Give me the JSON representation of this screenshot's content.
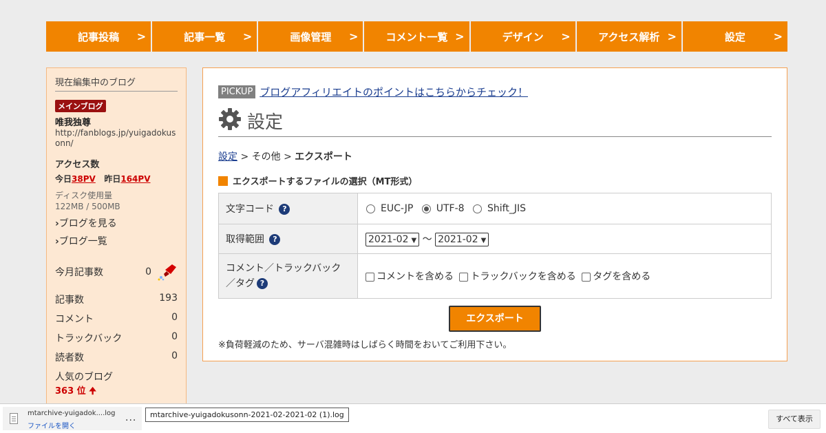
{
  "nav": {
    "items": [
      {
        "label": "記事投稿"
      },
      {
        "label": "記事一覧"
      },
      {
        "label": "画像管理"
      },
      {
        "label": "コメント一覧"
      },
      {
        "label": "デザイン"
      },
      {
        "label": "アクセス解析"
      },
      {
        "label": "設定"
      }
    ],
    "chevron": ">"
  },
  "sidebar": {
    "heading": "現在編集中のブログ",
    "badge": "メインブログ",
    "blog_name": "唯我独尊",
    "blog_url": "http://fanblogs.jp/yuigadokusonn/",
    "access_title": "アクセス数",
    "today_label": "今日",
    "today_value": "38PV",
    "yesterday_label": "昨日",
    "yesterday_value": "164PV",
    "disk_label": "ディスク使用量",
    "disk_value": "122MB / 500MB",
    "link_view": "ブログを見る",
    "link_list": "ブログ一覧",
    "link_arrow": "›",
    "stats": [
      {
        "label": "今月記事数",
        "value": "0"
      },
      {
        "label": "記事数",
        "value": "193"
      },
      {
        "label": "コメント",
        "value": "0"
      },
      {
        "label": "トラックバック",
        "value": "0"
      },
      {
        "label": "読者数",
        "value": "0"
      }
    ],
    "popular_label": "人気のブログ",
    "popular_rank": "363 位",
    "rank_arrow": "🠉"
  },
  "main": {
    "pickup_label": "PICKUP",
    "pickup_link": "ブログアフィリエイトのポイントはこちらからチェック！",
    "title": "設定",
    "breadcrumb": {
      "root": "設定",
      "sep1": " > ",
      "mid": "その他",
      "sep2": " > ",
      "current": "エクスポート"
    },
    "section_title": "エクスポートするファイルの選択（MT形式）",
    "rows": {
      "charset_label": "文字コード",
      "charset_options": [
        "EUC-JP",
        "UTF-8",
        "Shift_JIS"
      ],
      "charset_selected": "UTF-8",
      "range_label": "取得範囲",
      "range_from": "2021-02",
      "range_sep": "～",
      "range_to": "2021-02",
      "include_label_1": "コメント／トラックバック",
      "include_label_2": "／タグ",
      "include_options": [
        "コメントを含める",
        "トラックバックを含める",
        "タグを含める"
      ]
    },
    "help_glyph": "?",
    "export_button": "エクスポート",
    "note": "※負荷軽減のため、サーバ混雑時はしばらく時間をおいてご利用下さい。"
  },
  "download_bar": {
    "file_name": "mtarchive-yuigadok....log",
    "open_label": "ファイルを開く",
    "more": "...",
    "tooltip": "mtarchive-yuigadokusonn-2021-02-2021-02 (1).log",
    "show_all": "すべて表示"
  },
  "colors": {
    "accent": "#f18400",
    "badge": "#9a1010",
    "link": "#1a3d8f",
    "help": "#1d3b78"
  }
}
